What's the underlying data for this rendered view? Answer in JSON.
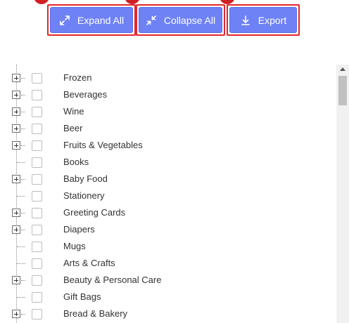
{
  "toolbar": {
    "expand_label": "Expand All",
    "collapse_label": "Collapse All",
    "export_label": "Export"
  },
  "icons": {
    "expand": "expand-arrows-icon",
    "collapse": "collapse-arrows-icon",
    "export": "download-icon"
  },
  "colors": {
    "button_bg": "#6e82f5",
    "highlight_border": "#e3262b",
    "marker": "#d01f23"
  },
  "tree": {
    "items": [
      {
        "label": "Frozen",
        "has_children": true
      },
      {
        "label": "Beverages",
        "has_children": true
      },
      {
        "label": "Wine",
        "has_children": true
      },
      {
        "label": "Beer",
        "has_children": true
      },
      {
        "label": "Fruits & Vegetables",
        "has_children": true
      },
      {
        "label": "Books",
        "has_children": false
      },
      {
        "label": "Baby Food",
        "has_children": true
      },
      {
        "label": "Stationery",
        "has_children": false
      },
      {
        "label": "Greeting Cards",
        "has_children": true
      },
      {
        "label": "Diapers",
        "has_children": true
      },
      {
        "label": "Mugs",
        "has_children": false
      },
      {
        "label": "Arts & Crafts",
        "has_children": false
      },
      {
        "label": "Beauty & Personal Care",
        "has_children": true
      },
      {
        "label": "Gift Bags",
        "has_children": false
      },
      {
        "label": "Bread & Bakery",
        "has_children": true
      }
    ]
  }
}
